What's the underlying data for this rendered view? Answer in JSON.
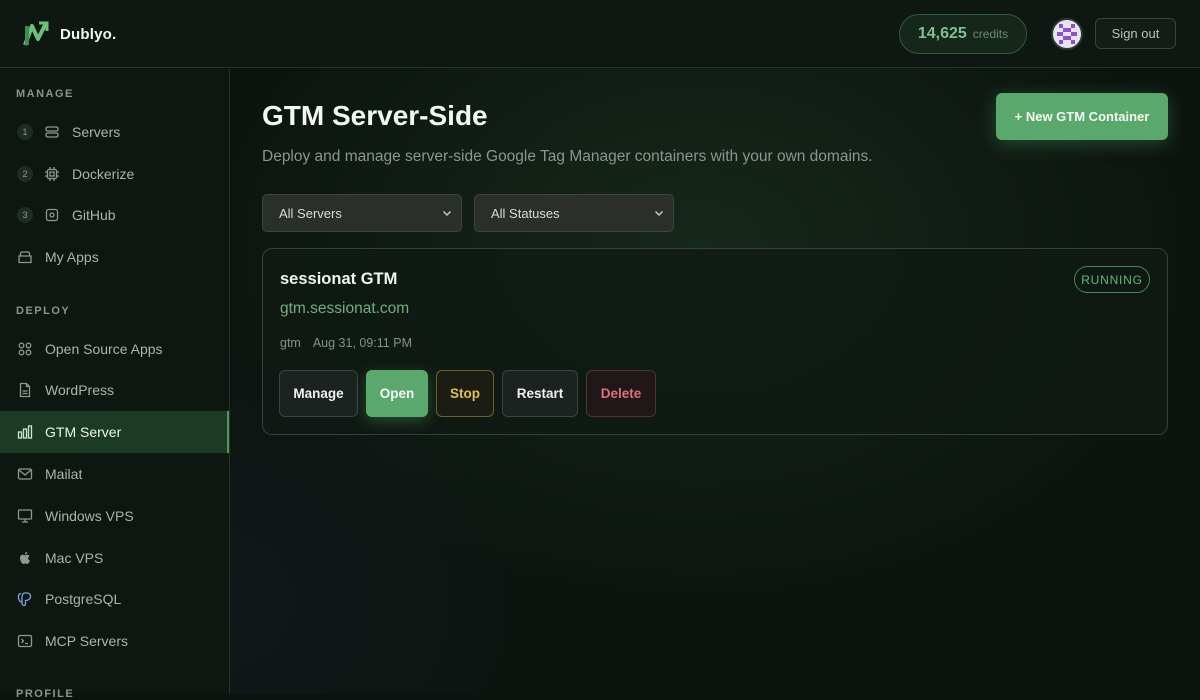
{
  "app": {
    "name": "Dublyo.",
    "credits_value": "14,625",
    "credits_label": "credits",
    "signout_label": "Sign out"
  },
  "sidebar": {
    "manage_label": "MANAGE",
    "manage_items": [
      {
        "num": "1",
        "label": "Servers",
        "icon": "server-icon"
      },
      {
        "num": "2",
        "label": "Dockerize",
        "icon": "chip-icon"
      },
      {
        "num": "3",
        "label": "GitHub",
        "icon": "github-icon"
      },
      {
        "label": "My Apps",
        "icon": "box-icon"
      }
    ],
    "deploy_label": "DEPLOY",
    "deploy_items": [
      {
        "label": "Open Source Apps",
        "icon": "grid-icon"
      },
      {
        "label": "WordPress",
        "icon": "file-icon"
      },
      {
        "label": "GTM Server",
        "icon": "bar-chart-icon",
        "active": true
      },
      {
        "label": "Mailat",
        "icon": "mail-icon"
      },
      {
        "label": "Windows VPS",
        "icon": "monitor-icon"
      },
      {
        "label": "Mac VPS",
        "icon": "apple-icon"
      },
      {
        "label": "PostgreSQL",
        "icon": "elephant-icon"
      },
      {
        "label": "MCP Servers",
        "icon": "terminal-icon"
      }
    ],
    "profile_label": "PROFILE"
  },
  "main": {
    "title": "GTM Server-Side",
    "subtitle": "Deploy and manage server-side Google Tag Manager containers with your own domains.",
    "new_button": "+ New GTM Container",
    "filters": {
      "servers": "All Servers",
      "statuses": "All Statuses"
    },
    "container": {
      "name": "sessionat GTM",
      "domain": "gtm.sessionat.com",
      "tag": "gtm",
      "date": "Aug 31, 09:11 PM",
      "status": "RUNNING",
      "actions": {
        "manage": "Manage",
        "open": "Open",
        "stop": "Stop",
        "restart": "Restart",
        "delete": "Delete"
      }
    }
  },
  "colors": {
    "accent": "#5aa86c",
    "status_running": "#5fba76",
    "stop": "#e0c04a",
    "delete": "#e0707d"
  }
}
